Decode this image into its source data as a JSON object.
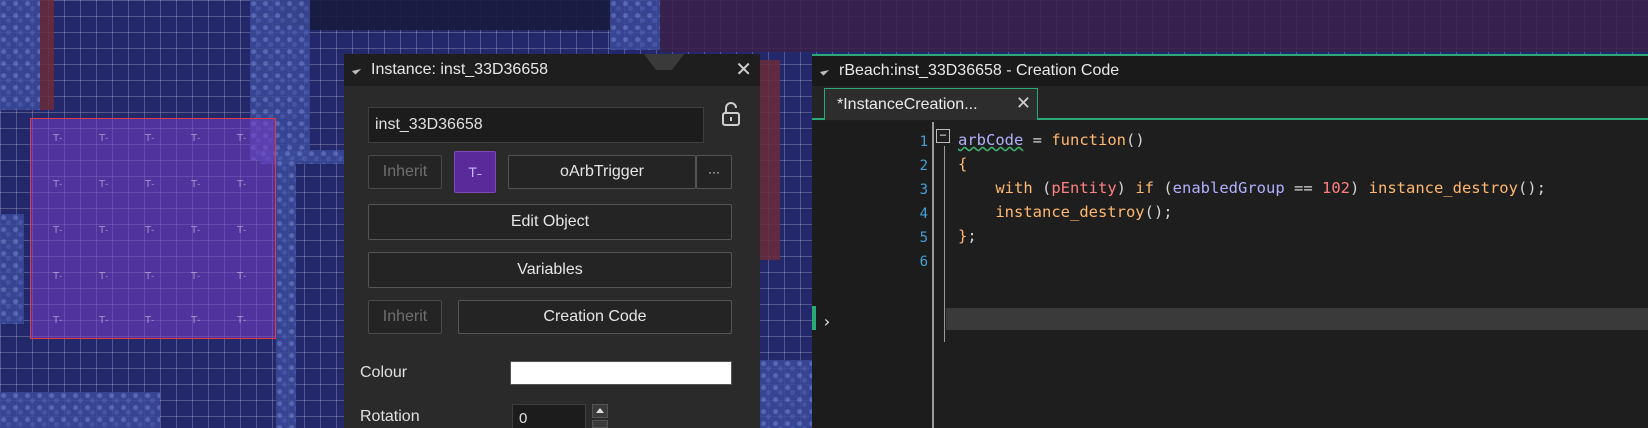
{
  "instance_window": {
    "title": "Instance: inst_33D36658",
    "name_value": "inst_33D36658",
    "inherit_label": "Inherit",
    "object_name": "oArbTrigger",
    "object_icon_glyph": "T˗",
    "more_label": "···",
    "edit_object_label": "Edit Object",
    "variables_label": "Variables",
    "inherit_label_2": "Inherit",
    "creation_code_label": "Creation Code",
    "colour_label": "Colour",
    "colour_value": "#ffffff",
    "rotation_label": "Rotation",
    "rotation_value": "0",
    "close_glyph": "✕"
  },
  "code_window": {
    "title": "rBeach:inst_33D36658 - Creation Code",
    "tab_label": "*InstanceCreation...",
    "tab_close_glyph": "✕",
    "line_numbers": [
      "1",
      "2",
      "3",
      "4",
      "5",
      "6"
    ],
    "accent_color": "#2aa876"
  },
  "code": {
    "l1_a": "arbCode",
    "l1_b": " = ",
    "l1_c": "function",
    "l1_d": "()",
    "l2": "{",
    "l3_indent": "    ",
    "l3_with": "with",
    "l3_p1": " (",
    "l3_ent": "pEntity",
    "l3_p2": ") ",
    "l3_if": "if",
    "l3_p3": " (",
    "l3_var": "enabledGroup",
    "l3_op": " == ",
    "l3_num": "102",
    "l3_p4": ") ",
    "l3_fn": "instance_destroy",
    "l3_end": "();",
    "l4_indent": "    ",
    "l4_fn": "instance_destroy",
    "l4_end": "();",
    "l5_brace": "}",
    "l5_end": ";"
  },
  "icons": {
    "collapse": "collapse-triangle-icon",
    "lock": "unlock-icon",
    "fold": "fold-minus-icon",
    "arrow": "chevron-right-icon"
  }
}
